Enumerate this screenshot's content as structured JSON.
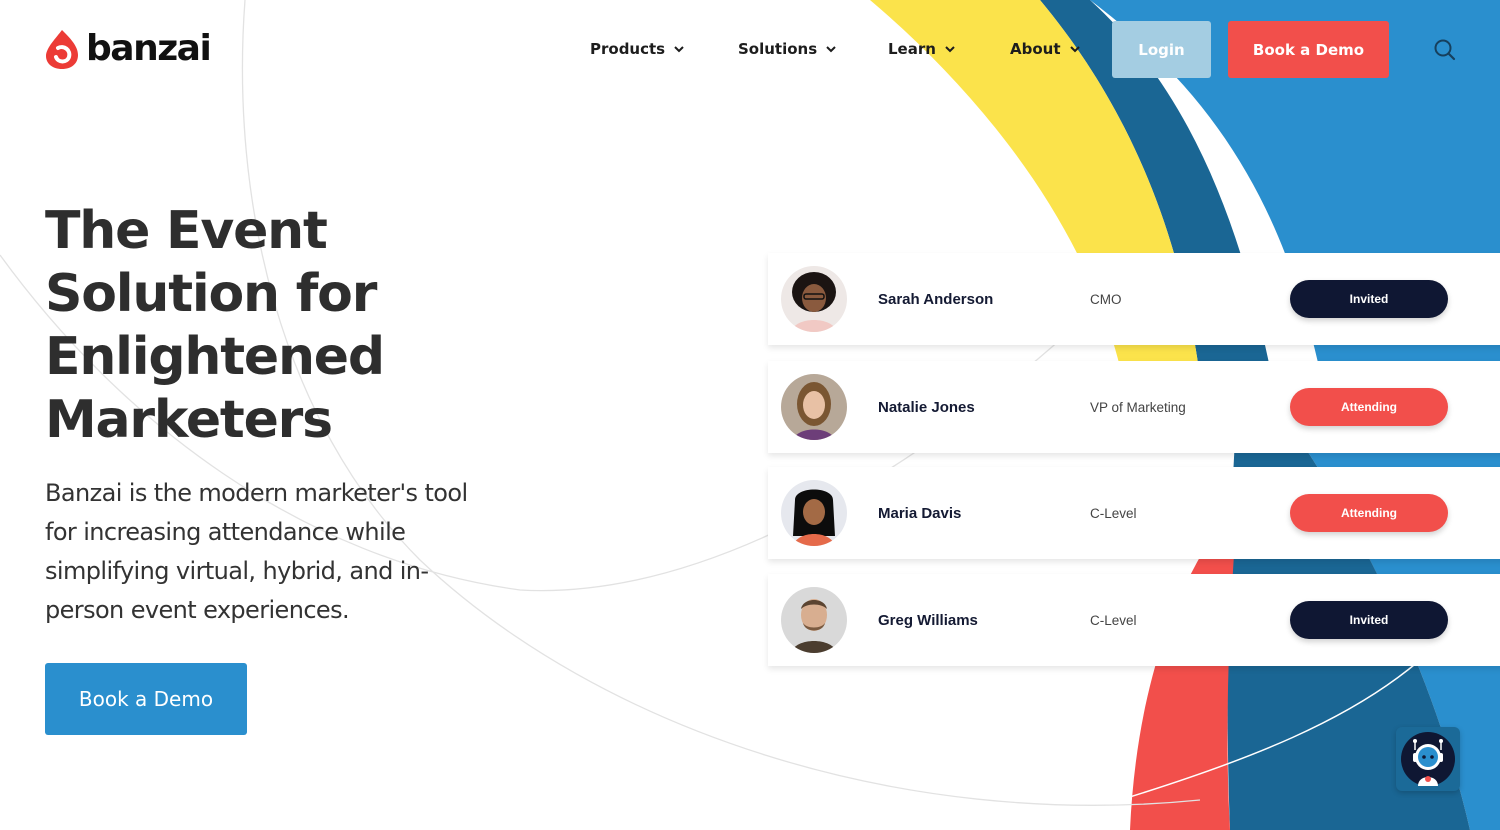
{
  "brand": {
    "name": "banzai",
    "colors": {
      "red": "#f24f4b",
      "yellow": "#fbe34b",
      "dark_blue": "#1a6694",
      "blue": "#2a8fce",
      "light_blue": "#a4cde2",
      "navy": "#0f1733"
    }
  },
  "nav": {
    "items": [
      {
        "label": "Products",
        "icon": "chevron-down-icon"
      },
      {
        "label": "Solutions",
        "icon": "chevron-down-icon"
      },
      {
        "label": "Learn",
        "icon": "chevron-down-icon"
      },
      {
        "label": "About",
        "icon": "chevron-down-icon"
      }
    ],
    "login_label": "Login",
    "demo_label": "Book a Demo",
    "search_icon": "search-icon"
  },
  "hero": {
    "title_lines": [
      "The Event",
      "Solution for",
      "Enlightened",
      "Marketers"
    ],
    "subtitle_lines": [
      "Banzai is the modern marketer's tool",
      "for increasing attendance while",
      "simplifying virtual, hybrid, and in-",
      "person event experiences."
    ],
    "cta_label": "Book a Demo"
  },
  "attendees": [
    {
      "name": "Sarah Anderson",
      "role": "CMO",
      "status": "Invited",
      "status_color": "#0f1733"
    },
    {
      "name": "Natalie Jones",
      "role": "VP of Marketing",
      "status": "Attending",
      "status_color": "#f24f4b"
    },
    {
      "name": "Maria Davis",
      "role": "C-Level",
      "status": "Attending",
      "status_color": "#f24f4b"
    },
    {
      "name": "Greg Williams",
      "role": "C-Level",
      "status": "Invited",
      "status_color": "#0f1733"
    }
  ],
  "chat": {
    "icon": "chatbot-robot-icon"
  }
}
